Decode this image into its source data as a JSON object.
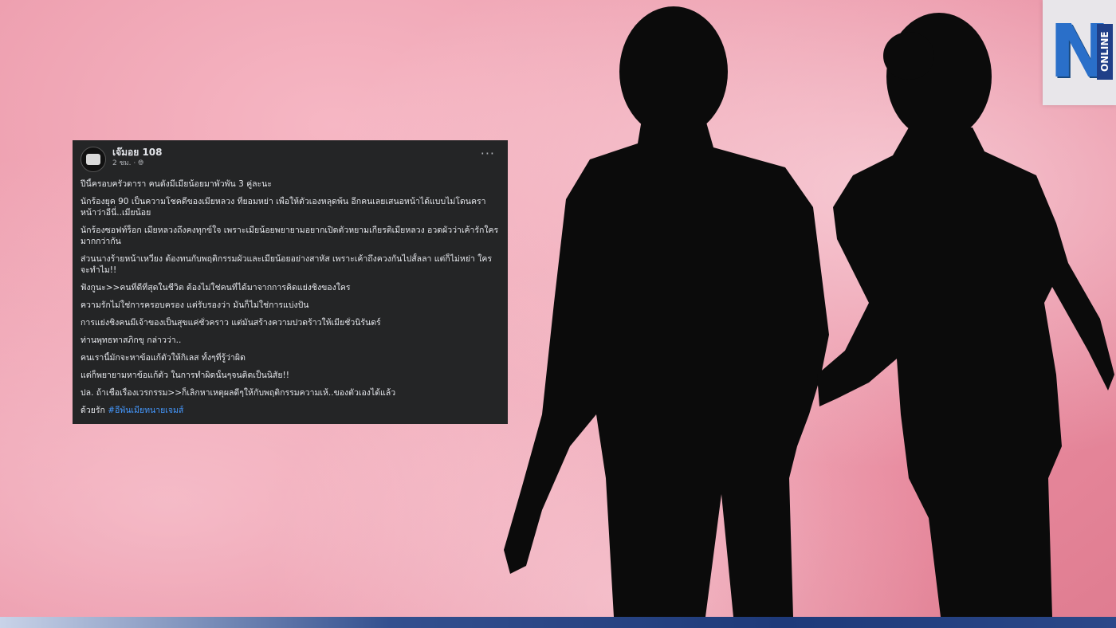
{
  "logo": {
    "mark": "N",
    "label": "ONLINE"
  },
  "post": {
    "author": "เจ๊มอย 108",
    "time": "2 ชม.",
    "more": "···",
    "lines": [
      "ปีนี้ครอบครัวดารา คนดังมีเมียน้อยมาพัวพัน 3 คู่ละนะ",
      "นักร้องยุค 90 เป็นความโชคดีของเมียหลวง ที่ยอมหย่า เพื่อให้ตัวเองหลุดพ้น อีกคนเลยเสนอหน้าได้แบบไม่โดนคราหน้าว่าอีนี่..เมียน้อย",
      "นักร้องซอฟท์ร็อก เมียหลวงถึงคงทุกข์ใจ เพราะเมียน้อยพยายามอยากเปิดตัวหยามเกียรติเมียหลวง อวดผัวว่าเค้ารักใครมากกว่ากัน",
      "ส่วนนางร้ายหน้าเหวี่ยง ต้องทนกับพฤติกรรมผัวและเมียน้อยอย่างสาหัส เพราะเค้าถึงควงกันไปสั้ลลา แต่ก็ไม่หย่า ใครจะทำไม!!",
      "ฟังกูนะ>>คนที่ดีที่สุดในชีวิต ต้องไม่ใช่คนที่ได้มาจากการคิดแย่งชิงของใคร",
      "ความรักไม่ใช่การครอบครอง แต่รับรองว่า มันก็ไม่ใช่การแบ่งปัน",
      "การแย่งชิงคนมีเจ้าของเป็นสุขแค่ชั่วคราว แต่มันสร้างความปวดร้าวให้เมียชั่วนิรันดร์",
      "ท่านพุทธทาสภิกขุ กล่าวว่า..",
      "คนเรานี้มักจะหาข้อแก้ตัวให้กิเลส ทั้งๆที่รู้ว่าผิด",
      "แต่ก็พยายามหาข้อแก้ตัว ในการทำผิดนั้นๆจนติดเป็นนิสัย!!",
      "ปล. ถ้าเชื่อเรื่องเวรกรรม>>ก็เลิกหาเหตุผลดีๆให้กับพฤติกรรมความเห้..ของตัวเองได้แล้ว"
    ],
    "closing_prefix": "ด้วยรัก",
    "hashtag": "#อีพันเมียทนายเจมส์"
  },
  "colors": {
    "post_bg": "#242526",
    "hashtag": "#4599ff",
    "logo_blue": "#2a6fc9",
    "bottom_bar": "#1e3a7a"
  }
}
